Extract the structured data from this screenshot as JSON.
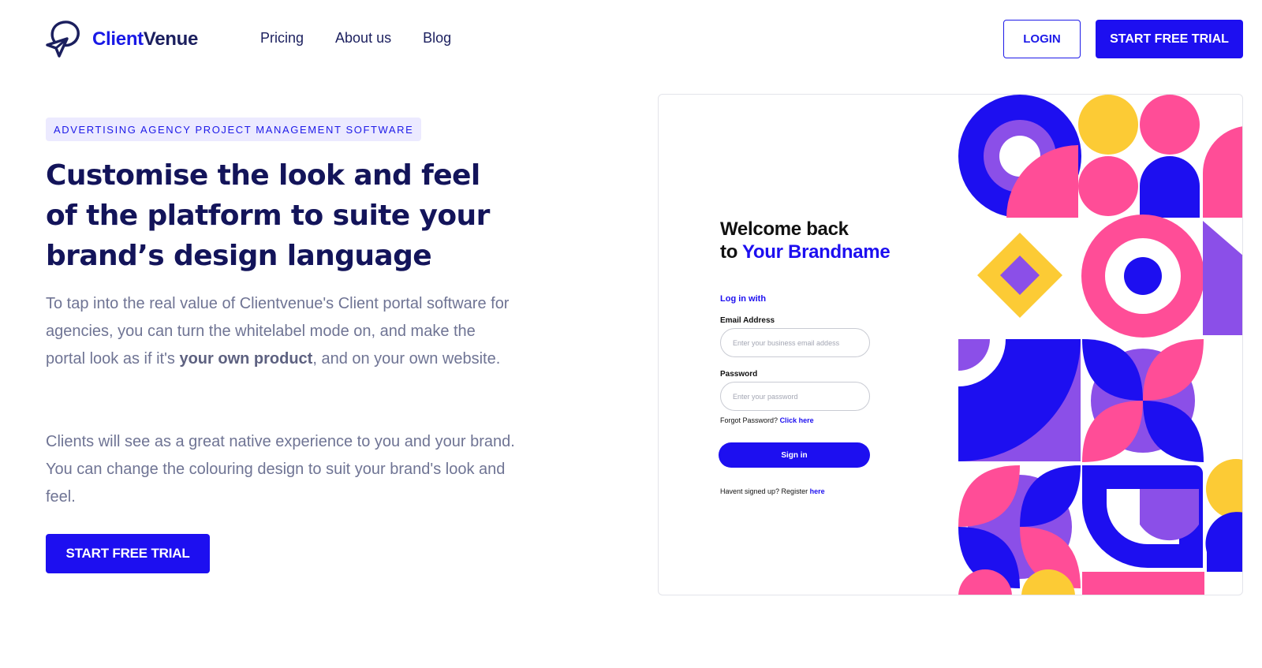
{
  "header": {
    "logo": {
      "part1": "Client",
      "part2": "Venue"
    },
    "nav": [
      "Pricing",
      "About us",
      "Blog"
    ],
    "login_label": "LOGIN",
    "trial_label": "START FREE TRIAL"
  },
  "hero": {
    "tag": "ADVERTISING AGENCY PROJECT MANAGEMENT SOFTWARE",
    "headline": "Customise the look and feel of the platform to suite your brand’s design language",
    "p1_before": "To tap into the real value of Clientvenue's Client portal software for agencies, you can turn the whitelabel mode on, and make the portal look as if it's ",
    "p1_bold": "your own product",
    "p1_after": ", and on your own website.",
    "p2": "Clients will see as a great native experience to you and your brand. You can change the colouring design to suit your brand's look and feel.",
    "cta_label": "START FREE TRIAL"
  },
  "preview": {
    "welcome_line1": "Welcome back",
    "welcome_to": "to",
    "brand_name": "Your Brandname",
    "login_with": "Log in with",
    "email_label": "Email Address",
    "email_placeholder": "Enter your business email addess",
    "password_label": "Password",
    "password_placeholder": "Enter your password",
    "forgot_text": "Forgot Password?",
    "forgot_link": "Click here",
    "signin_label": "Sign in",
    "signup_text": "Havent signed up? Register",
    "signup_link": "here"
  },
  "colors": {
    "brand_blue": "#1d0ff0",
    "navy": "#13145a",
    "pink": "#ff4d97",
    "yellow": "#fccb35",
    "purple": "#8b4fe8"
  }
}
